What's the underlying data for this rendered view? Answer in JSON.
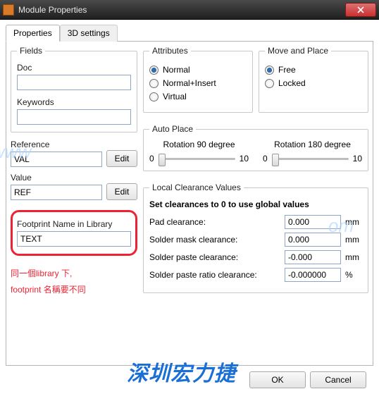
{
  "window": {
    "title": "Module Properties"
  },
  "tabs": {
    "properties": "Properties",
    "threeD": "3D settings"
  },
  "fields": {
    "legend": "Fields",
    "doc_label": "Doc",
    "doc_value": "",
    "keywords_label": "Keywords",
    "keywords_value": ""
  },
  "reference": {
    "label": "Reference",
    "value": "VAL",
    "edit": "Edit"
  },
  "value": {
    "label": "Value",
    "value": "REF",
    "edit": "Edit"
  },
  "footprint": {
    "label": "Footprint Name in Library",
    "value": "TEXT"
  },
  "annotation": {
    "line1": "同一個library 下,",
    "line2": "footprint 名稱要不同"
  },
  "attributes": {
    "legend": "Attributes",
    "normal": "Normal",
    "normal_insert": "Normal+Insert",
    "virtual": "Virtual"
  },
  "move_place": {
    "legend": "Move and Place",
    "free": "Free",
    "locked": "Locked"
  },
  "autoplace": {
    "legend": "Auto Place",
    "rot90": "Rotation 90 degree",
    "rot180": "Rotation 180 degree",
    "min": "0",
    "max": "10"
  },
  "clearances": {
    "legend": "Local Clearance Values",
    "hint": "Set clearances to 0 to use global values",
    "pad_label": "Pad clearance:",
    "pad_value": "0.000",
    "mask_label": "Solder mask clearance:",
    "mask_value": "0.000",
    "paste_label": "Solder paste clearance:",
    "paste_value": "-0.000",
    "ratio_label": "Solder paste ratio clearance:",
    "ratio_value": "-0.000000",
    "mm": "mm",
    "pct": "%"
  },
  "footer": {
    "ok": "OK",
    "cancel": "Cancel"
  },
  "watermark": {
    "brand": "深圳宏力捷",
    "url1": "www",
    "url2": "om"
  }
}
